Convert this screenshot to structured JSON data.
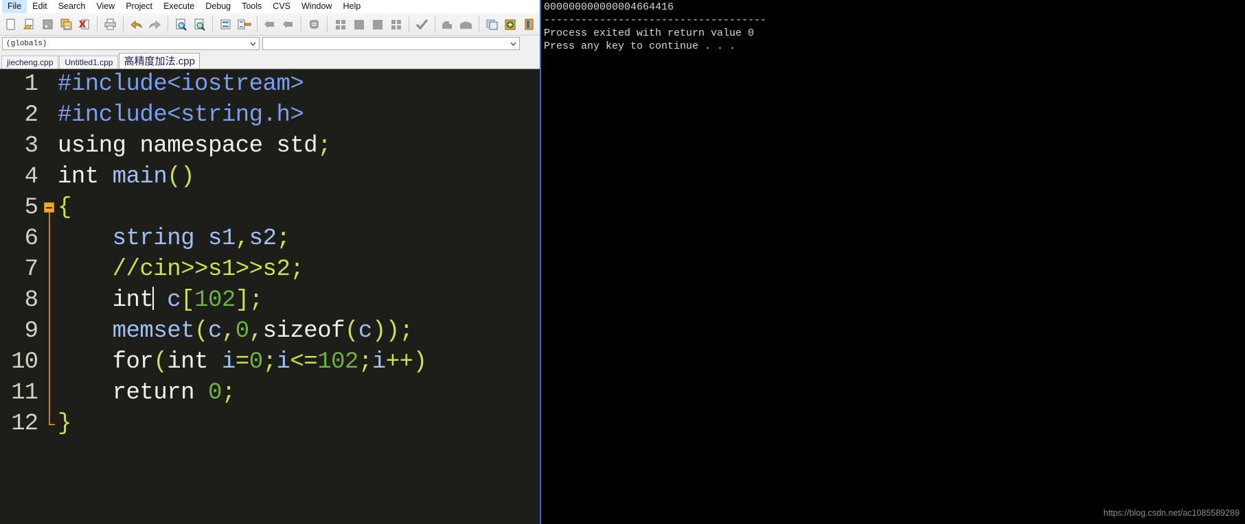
{
  "menubar": {
    "items": [
      {
        "label": "File",
        "active": true
      },
      {
        "label": "Edit",
        "active": false
      },
      {
        "label": "Search",
        "active": false
      },
      {
        "label": "View",
        "active": false
      },
      {
        "label": "Project",
        "active": false
      },
      {
        "label": "Execute",
        "active": false
      },
      {
        "label": "Debug",
        "active": false
      },
      {
        "label": "Tools",
        "active": false
      },
      {
        "label": "CVS",
        "active": false
      },
      {
        "label": "Window",
        "active": false
      },
      {
        "label": "Help",
        "active": false
      }
    ]
  },
  "toolbar": {
    "buttons": [
      {
        "icon": "new-file-icon"
      },
      {
        "icon": "open-file-icon"
      },
      {
        "icon": "save-file-icon"
      },
      {
        "icon": "save-all-icon"
      },
      {
        "icon": "close-file-icon"
      },
      {
        "icon": "print-icon"
      },
      {
        "icon": "undo-icon"
      },
      {
        "icon": "redo-icon"
      },
      {
        "icon": "find-icon"
      },
      {
        "icon": "replace-icon"
      },
      {
        "icon": "goto-line-icon"
      },
      {
        "icon": "toggle-bookmark-icon"
      },
      {
        "icon": "step-back-icon"
      },
      {
        "icon": "step-forward-icon"
      },
      {
        "icon": "compile-icon"
      },
      {
        "icon": "new-project-icon"
      },
      {
        "icon": "project-options-icon"
      },
      {
        "icon": "compile-run-icon"
      },
      {
        "icon": "rebuild-all-icon"
      },
      {
        "icon": "check-syntax-icon"
      },
      {
        "icon": "debug-icon"
      },
      {
        "icon": "profile-icon"
      },
      {
        "icon": "window-tile-icon"
      },
      {
        "icon": "window-cascade-icon"
      },
      {
        "icon": "window-close-icon"
      }
    ]
  },
  "combos": {
    "scope": {
      "value": "(globals)",
      "placeholder": ""
    },
    "member": {
      "value": "",
      "placeholder": ""
    }
  },
  "tabs": [
    {
      "label": "jiecheng.cpp",
      "active": false
    },
    {
      "label": "Untitled1.cpp",
      "active": false
    },
    {
      "label": "高精度加法.cpp",
      "active": true
    }
  ],
  "editor": {
    "background": "#1d1e19",
    "lines": [
      {
        "n": "1",
        "fold": "none"
      },
      {
        "n": "2",
        "fold": "none"
      },
      {
        "n": "3",
        "fold": "none"
      },
      {
        "n": "4",
        "fold": "none"
      },
      {
        "n": "5",
        "fold": "start"
      },
      {
        "n": "6",
        "fold": "mid"
      },
      {
        "n": "7",
        "fold": "mid"
      },
      {
        "n": "8",
        "fold": "mid"
      },
      {
        "n": "9",
        "fold": "mid"
      },
      {
        "n": "10",
        "fold": "mid"
      },
      {
        "n": "11",
        "fold": "mid"
      },
      {
        "n": "12",
        "fold": "end"
      }
    ],
    "code": {
      "l1": "#include<iostream>",
      "l2": "#include<string.h>",
      "l3": "using namespace std;",
      "l4": "int main()",
      "l5": "{",
      "l6": "    string s1,s2;",
      "l7": "    //cin>>s1>>s2;",
      "l8": "    int c[102];",
      "l9": "    memset(c,0,sizeof(c));",
      "l10": "    for(int i=0;i<=102;i++)",
      "l11": "    return 0;",
      "l12": "}"
    },
    "tokens": {
      "l1": {
        "pre": "#include<iostream>"
      },
      "l2": {
        "pre": "#include<string.h>"
      },
      "l3": {
        "kw_using": "using",
        "kw_namespace": "namespace",
        "id_std": "std",
        "semi": ";"
      },
      "l4": {
        "type_int": "int",
        "fn_main": "main",
        "parens": "()"
      },
      "l5": {
        "brace": "{"
      },
      "l6": {
        "type_string": "string",
        "id_s1": "s1",
        "comma": ",",
        "id_s2": "s2",
        "semi": ";"
      },
      "l7": {
        "comment": "//cin>>s1>>s2;"
      },
      "l8": {
        "type_int": "int",
        "id_c": "c",
        "lb": "[",
        "num": "102",
        "rb": "]",
        "semi": ";"
      },
      "l9": {
        "fn_memset": "memset",
        "lp": "(",
        "id_c": "c",
        "c1": ",",
        "num0": "0",
        "c2": ",",
        "kw_sizeof": "sizeof",
        "lp2": "(",
        "id_c2": "c",
        "rp2": ")",
        "rp": ")",
        "semi": ";"
      },
      "l10": {
        "kw_for": "for",
        "lp": "(",
        "type_int": "int",
        "id_i": "i",
        "eq": "=",
        "num0": "0",
        "semi1": ";",
        "id_i2": "i",
        "le": "<=",
        "num102": "102",
        "semi2": ";",
        "id_i3": "i",
        "inc": "++",
        "rp": ")"
      },
      "l11": {
        "kw_return": "return",
        "num0": "0",
        "semi": ";"
      },
      "l12": {
        "brace": "}"
      }
    },
    "caret": {
      "line": 8,
      "after_text": "int"
    }
  },
  "console": {
    "lines": [
      "000000000000004664416",
      "------------------------------------",
      "Process exited with return value 0",
      "Press any key to continue . . ."
    ]
  },
  "watermark": "https://blog.csdn.net/ac1085589289"
}
